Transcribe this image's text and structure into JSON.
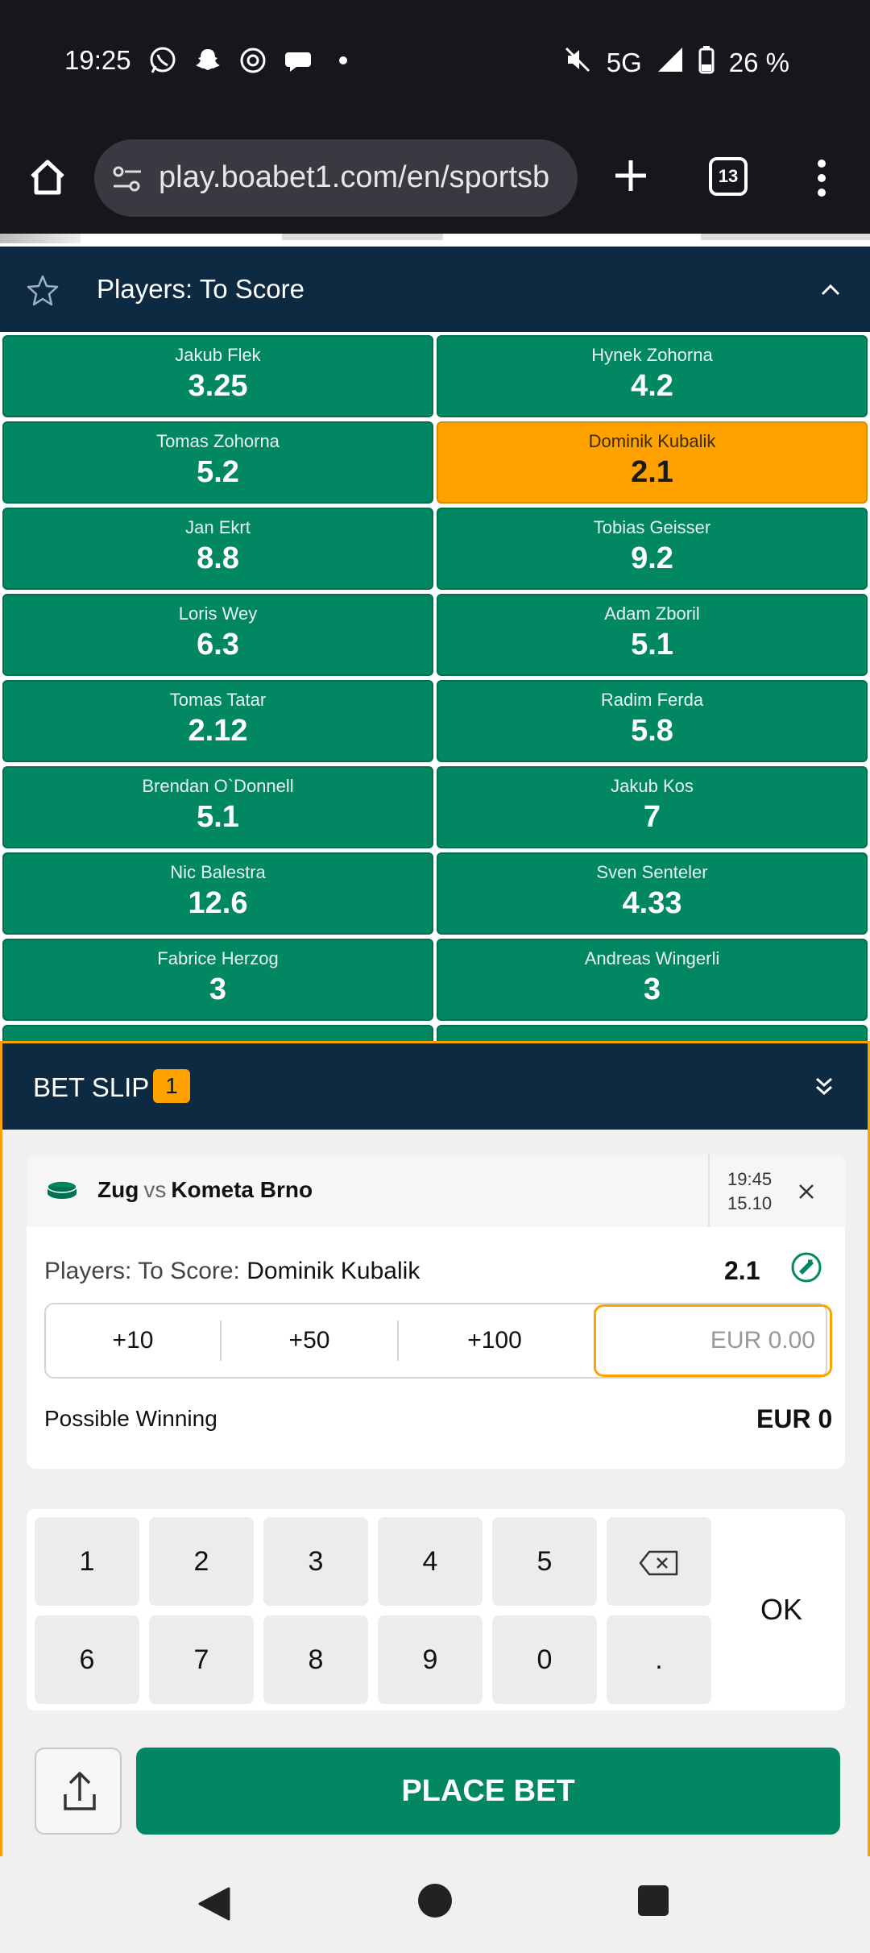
{
  "status_bar": {
    "time": "19:25",
    "network": "5G",
    "battery": "26 %",
    "notification_icons": [
      "whatsapp-icon",
      "snapchat-icon",
      "threads-icon",
      "chat-bubble-icon",
      "dot-icon"
    ]
  },
  "browser": {
    "url": "play.boabet1.com/en/sportsb",
    "tab_count": "13"
  },
  "market": {
    "title": "Players: To Score",
    "odds": [
      {
        "name": "Jakub Flek",
        "value": "3.25"
      },
      {
        "name": "Hynek Zohorna",
        "value": "4.2"
      },
      {
        "name": "Tomas Zohorna",
        "value": "5.2"
      },
      {
        "name": "Dominik Kubalik",
        "value": "2.1",
        "selected": true
      },
      {
        "name": "Jan Ekrt",
        "value": "8.8"
      },
      {
        "name": "Tobias Geisser",
        "value": "9.2"
      },
      {
        "name": "Loris Wey",
        "value": "6.3"
      },
      {
        "name": "Adam Zboril",
        "value": "5.1"
      },
      {
        "name": "Tomas Tatar",
        "value": "2.12"
      },
      {
        "name": "Radim Ferda",
        "value": "5.8"
      },
      {
        "name": "Brendan O`Donnell",
        "value": "5.1"
      },
      {
        "name": "Jakub Kos",
        "value": "7"
      },
      {
        "name": "Nic Balestra",
        "value": "12.6"
      },
      {
        "name": "Sven Senteler",
        "value": "4.33"
      },
      {
        "name": "Fabrice Herzog",
        "value": "3"
      },
      {
        "name": "Andreas Wingerli",
        "value": "3"
      }
    ]
  },
  "bet_slip": {
    "title": "BET SLIP",
    "count": "1",
    "home_team": "Zug",
    "vs": "vs",
    "away_team": "Kometa Brno",
    "time": "19:45",
    "date": "15.10",
    "market_label": "Players: To Score:",
    "selection": "Dominik Kubalik",
    "odd": "2.1",
    "quick_stakes": [
      "+10",
      "+50",
      "+100"
    ],
    "stake_placeholder": "EUR 0.00",
    "possible_winning_label": "Possible Winning",
    "possible_winning_value": "EUR 0",
    "keys": [
      "1",
      "2",
      "3",
      "4",
      "5",
      "6",
      "7",
      "8",
      "9",
      "0",
      "."
    ],
    "ok_label": "OK",
    "place_bet_label": "PLACE BET"
  },
  "colors": {
    "odd_green": "#028763",
    "selected_orange": "#ffa200",
    "header_navy": "#0e2942"
  }
}
